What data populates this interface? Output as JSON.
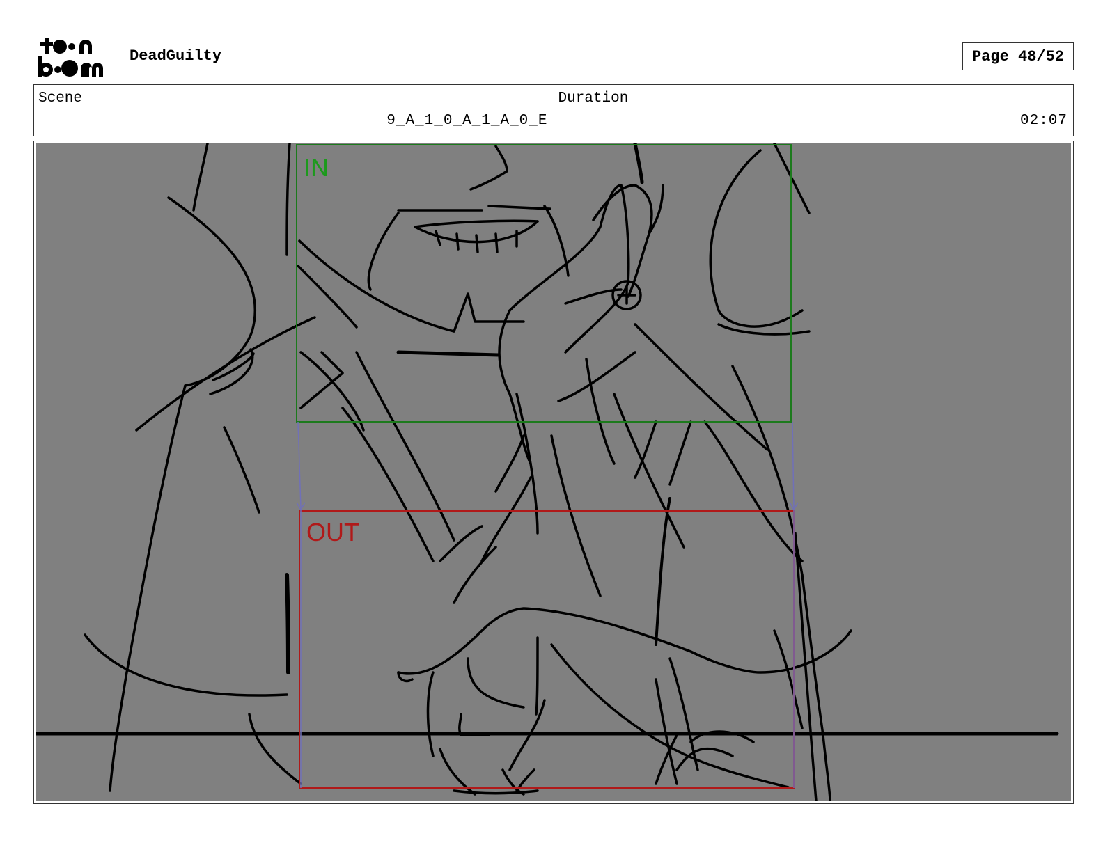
{
  "header": {
    "logo_text": "toon boom",
    "project_title": "DeadGuilty",
    "page_label": "Page 48/52"
  },
  "info": {
    "scene_label": "Scene",
    "scene_value": "9_A_1_0_A_1_A_0_E",
    "duration_label": "Duration",
    "duration_value": "02:07"
  },
  "panel": {
    "background_color": "#808080",
    "camera_in_label": "IN",
    "camera_out_label": "OUT",
    "camera_in_color": "#1c7a1c",
    "camera_out_color": "#b01919"
  }
}
